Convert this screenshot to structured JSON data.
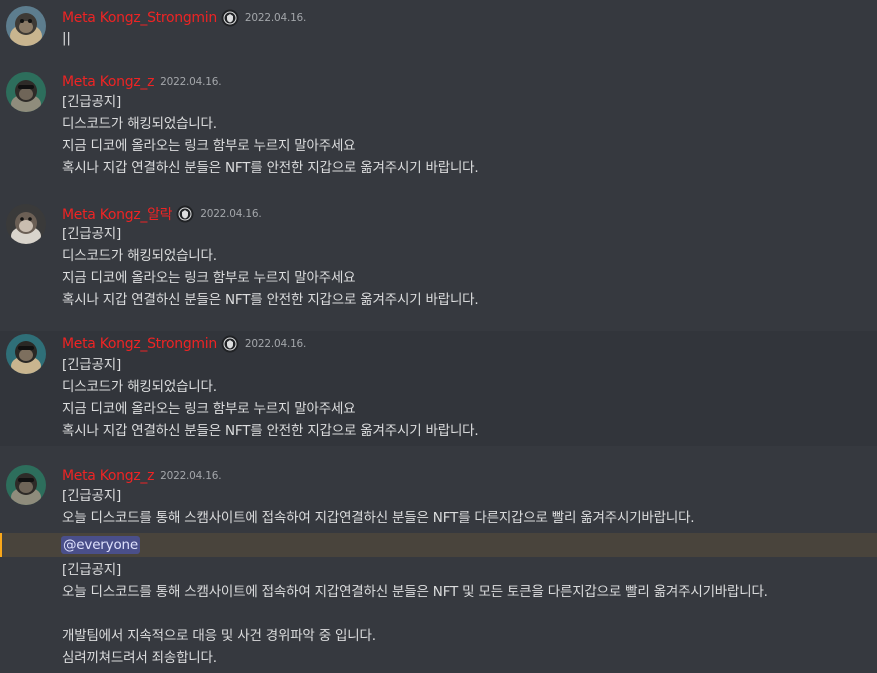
{
  "messages": [
    {
      "username": "Meta Kongz_Strongmin",
      "timestamp": "2022.04.16.",
      "lines": [
        "||"
      ]
    },
    {
      "username": "Meta Kongz_z",
      "timestamp": "2022.04.16.",
      "lines": [
        "[긴급공지]",
        "디스코드가 해킹되었습니다.",
        "지금 디코에 올라오는 링크 함부로 누르지 말아주세요",
        "혹시나 지갑 연결하신 분들은 NFT를 안전한 지갑으로 옮겨주시기 바랍니다."
      ]
    },
    {
      "username": "Meta Kongz_알락",
      "timestamp": "2022.04.16.",
      "lines": [
        "[긴급공지]",
        "디스코드가 해킹되었습니다.",
        "지금 디코에 올라오는 링크 함부로 누르지 말아주세요",
        "혹시나 지갑 연결하신 분들은 NFT를 안전한 지갑으로 옮겨주시기 바랍니다."
      ]
    },
    {
      "username": "Meta Kongz_Strongmin",
      "timestamp": "2022.04.16.",
      "lines": [
        "[긴급공지]",
        "디스코드가 해킹되었습니다.",
        "지금 디코에 올라오는 링크 함부로 누르지 말아주세요",
        "혹시나 지갑 연결하신 분들은 NFT를 안전한 지갑으로 옮겨주시기 바랍니다."
      ]
    },
    {
      "username": "Meta Kongz_z",
      "timestamp": "2022.04.16.",
      "lines": [
        "[긴급공지]",
        "오늘 디스코드를 통해 스캠사이트에 접속하여 지갑연결하신 분들은 NFT를 다른지갑으로 빨리 옮겨주시기바랍니다."
      ],
      "mention": "@everyone",
      "after_lines": [
        "[긴급공지]",
        "오늘 디스코드를 통해 스캠사이트에 접속하여 지갑연결하신 분들은 NFT 및 모든 토큰을 다른지갑으로 빨리 옮겨주시기바랍니다.",
        "",
        "개발팀에서 지속적으로 대응 및 사건 경위파악 중 입니다.",
        "심려끼쳐드려서 죄송합니다."
      ]
    }
  ],
  "colors": {
    "background": "#36393f",
    "username": "#ed2424",
    "text": "#dcddde",
    "timestamp": "#a3a6aa",
    "mention_bg": "#4a4f8a",
    "mention_band": "#49443c",
    "mention_bar": "#faa81a"
  },
  "icons": {
    "badge": "verified-shield-icon"
  }
}
